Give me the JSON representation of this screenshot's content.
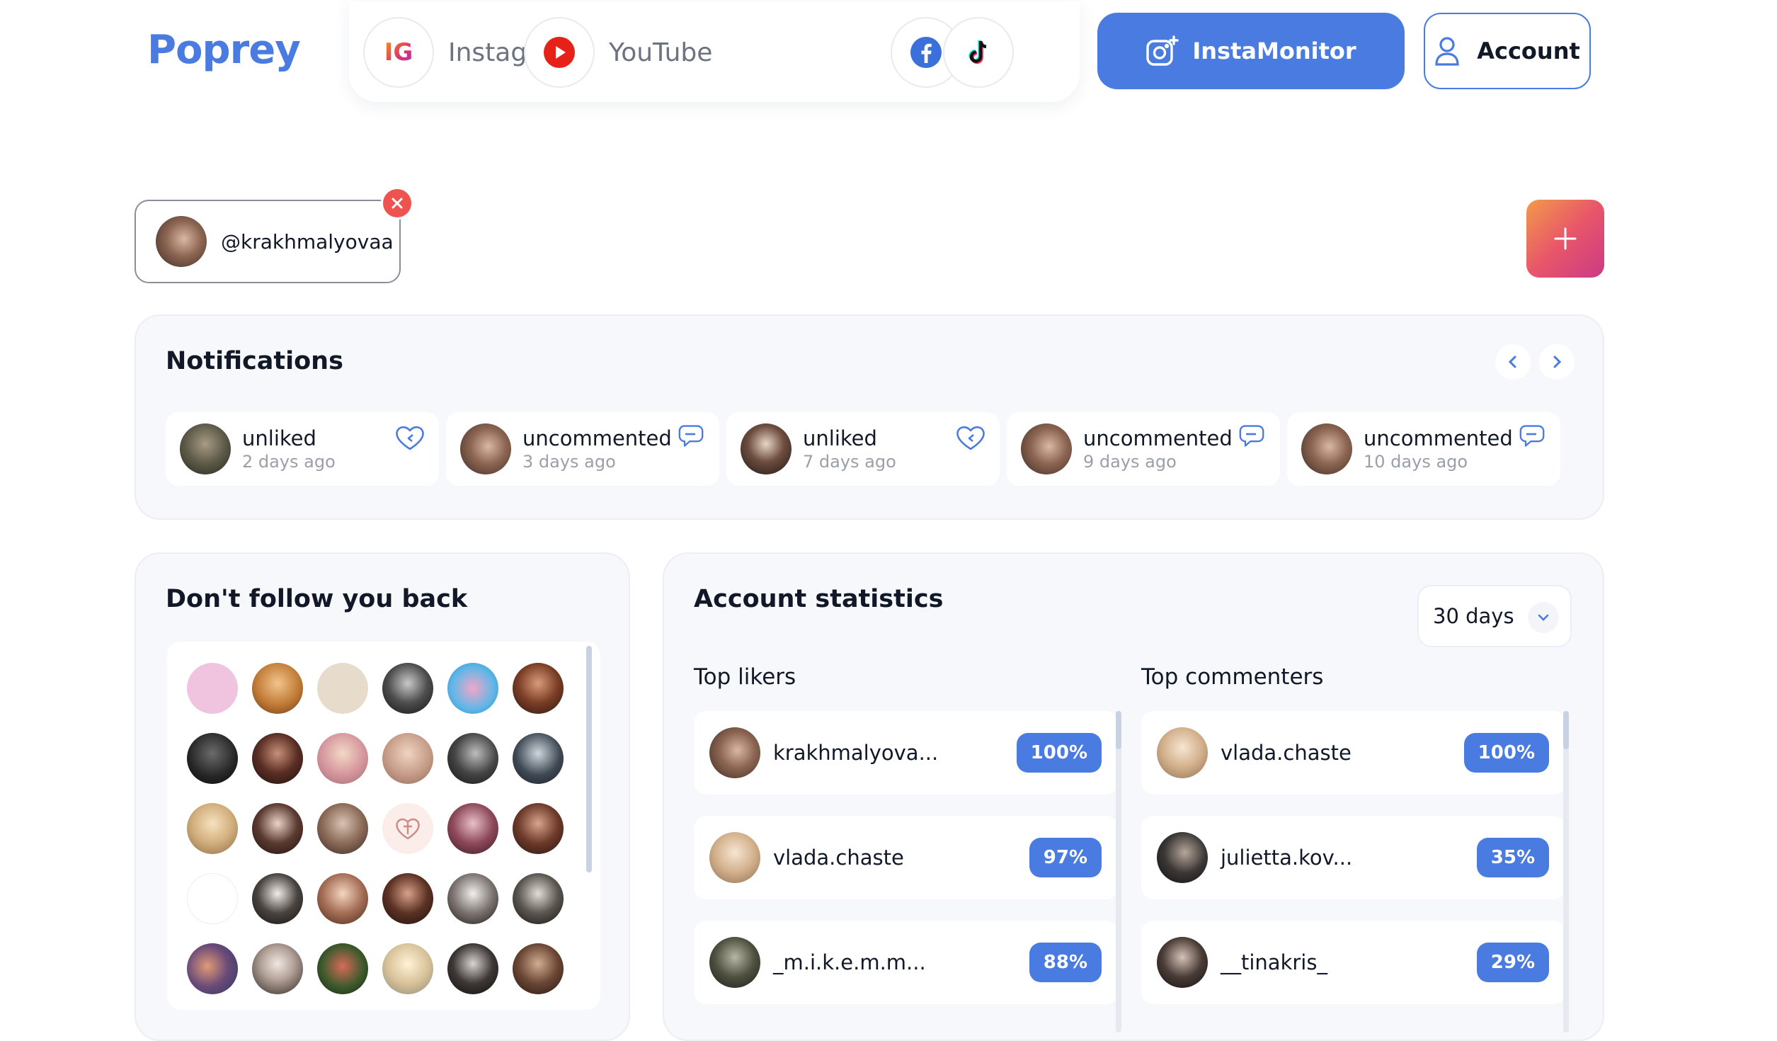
{
  "header": {
    "logo": "Poprey",
    "nav": [
      {
        "label": "Instagram",
        "icon": "instagram-icon",
        "badge": "IG"
      },
      {
        "label": "YouTube",
        "icon": "youtube-icon"
      },
      {
        "label": "",
        "icon": "facebook-icon"
      },
      {
        "label": "",
        "icon": "tiktok-icon"
      }
    ],
    "insta_monitor_label": "InstaMonitor",
    "account_label": "Account"
  },
  "tracked_account": {
    "handle": "@krakhmalyovaa"
  },
  "notifications": {
    "title": "Notifications",
    "items": [
      {
        "action": "unliked",
        "time": "2 days ago",
        "type": "like"
      },
      {
        "action": "uncommented",
        "time": "3 days ago",
        "type": "comment"
      },
      {
        "action": "unliked",
        "time": "7 days ago",
        "type": "like"
      },
      {
        "action": "uncommented",
        "time": "9 days ago",
        "type": "comment"
      },
      {
        "action": "uncommented",
        "time": "10 days ago",
        "type": "comment"
      }
    ]
  },
  "dont_follow_back": {
    "title": "Don't follow you back",
    "avatar_count": 30
  },
  "account_statistics": {
    "title": "Account statistics",
    "period": "30 days",
    "top_likers": {
      "title": "Top likers",
      "rows": [
        {
          "user": "krakhmalyova...",
          "percent": "100%"
        },
        {
          "user": "vlada.chaste",
          "percent": "97%"
        },
        {
          "user": "_m.i.k.e.m.m...",
          "percent": "88%"
        }
      ]
    },
    "top_commenters": {
      "title": "Top commenters",
      "rows": [
        {
          "user": "vlada.chaste",
          "percent": "100%"
        },
        {
          "user": "julietta.kov...",
          "percent": "35%"
        },
        {
          "user": "__tinakris_",
          "percent": "29%"
        }
      ]
    }
  },
  "colors": {
    "accent": "#4a7be0",
    "danger": "#ef5350",
    "panel": "#f7f8fb"
  }
}
